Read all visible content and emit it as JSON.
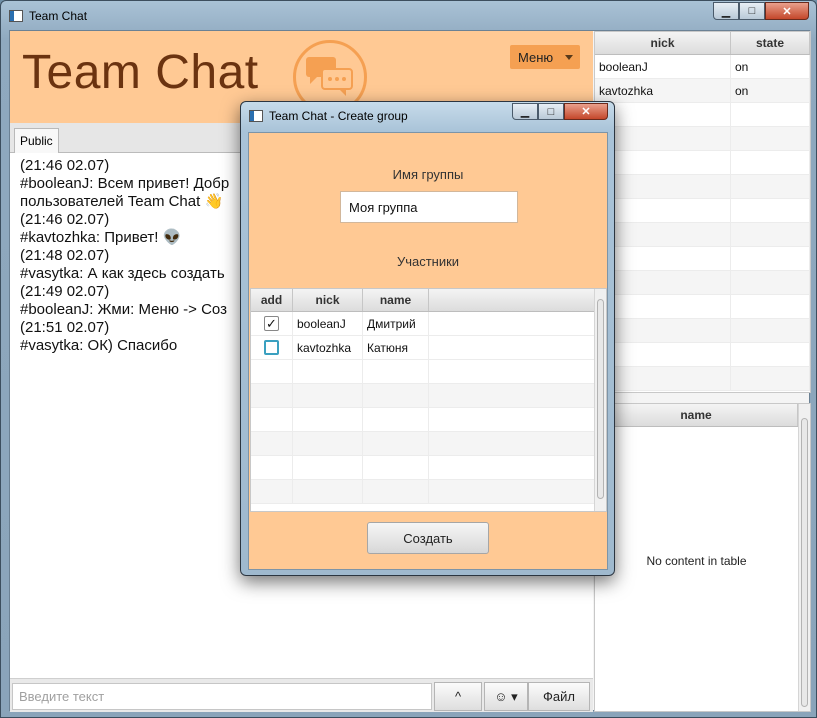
{
  "window": {
    "title": "Team Chat",
    "controls": {
      "minimize": "▁",
      "maximize": "□",
      "close": "✕"
    }
  },
  "header": {
    "logo_text": "Team Chat",
    "menu_label": "Меню",
    "accent_color": "#ffc994",
    "brand_text_color": "#6b3310"
  },
  "tabs": [
    {
      "label": "Public"
    }
  ],
  "chat": {
    "lines": [
      "(21:46 02.07)",
      "#booleanJ: Всем привет! Добр",
      "пользователей Team Chat  👋",
      "(21:46 02.07)",
      "#kavtozhka: Привет! 👽",
      "(21:48 02.07)",
      "#vasytka: А как здесь создать",
      "(21:49 02.07)",
      "#booleanJ: Жми: Меню -> Соз",
      "(21:51 02.07)",
      "#vasytka: ОК) Спасибо"
    ]
  },
  "input_bar": {
    "placeholder": "Введите текст",
    "send_up_label": "^",
    "emoji_label": "☺ ▾",
    "file_label": "Файл"
  },
  "users_table": {
    "columns": [
      "nick",
      "state"
    ],
    "rows": [
      {
        "nick": "booleanJ",
        "state": "on"
      },
      {
        "nick": "kavtozhka",
        "state": "on"
      }
    ]
  },
  "groups_table": {
    "columns": [
      "name"
    ],
    "empty_text": "No content in table"
  },
  "dialog": {
    "title": "Team Chat - Create group",
    "group_name_label": "Имя группы",
    "group_name_value": "Моя группа",
    "members_label": "Участники",
    "columns": [
      "add",
      "nick",
      "name"
    ],
    "rows": [
      {
        "checked": true,
        "check_glyph": "✓",
        "nick": "booleanJ",
        "name": "Дмитрий"
      },
      {
        "checked": false,
        "check_glyph": "",
        "nick": "kavtozhka",
        "name": "Катюня"
      }
    ],
    "create_label": "Создать"
  }
}
